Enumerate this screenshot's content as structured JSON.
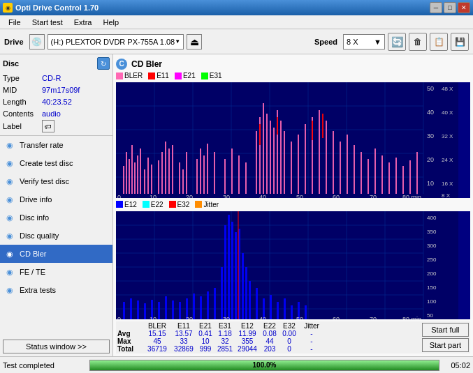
{
  "titleBar": {
    "icon": "◉",
    "title": "Opti Drive Control 1.70",
    "minBtn": "─",
    "maxBtn": "□",
    "closeBtn": "✕"
  },
  "menu": {
    "items": [
      "File",
      "Start test",
      "Extra",
      "Help"
    ]
  },
  "toolbar": {
    "driveLabel": "Drive",
    "driveIcon": "💿",
    "driveValue": "(H:)  PLEXTOR DVDR  PX-755A 1.08",
    "ejectIcon": "⏏",
    "speedLabel": "Speed",
    "speedValue": "8 X",
    "icons": [
      "🔄",
      "🗑",
      "📋",
      "💾"
    ]
  },
  "disc": {
    "title": "Disc",
    "refreshIcon": "↻",
    "fields": [
      {
        "label": "Type",
        "value": "CD-R"
      },
      {
        "label": "MID",
        "value": "97m17s09f"
      },
      {
        "label": "Length",
        "value": "40:23.52"
      },
      {
        "label": "Contents",
        "value": "audio"
      },
      {
        "label": "Label",
        "value": ""
      }
    ]
  },
  "sidebar": {
    "items": [
      {
        "id": "transfer-rate",
        "label": "Transfer rate",
        "icon": "◉"
      },
      {
        "id": "create-test-disc",
        "label": "Create test disc",
        "icon": "◉"
      },
      {
        "id": "verify-test-disc",
        "label": "Verify test disc",
        "icon": "◉"
      },
      {
        "id": "drive-info",
        "label": "Drive info",
        "icon": "◉"
      },
      {
        "id": "disc-info",
        "label": "Disc info",
        "icon": "◉"
      },
      {
        "id": "disc-quality",
        "label": "Disc quality",
        "icon": "◉"
      },
      {
        "id": "cd-bler",
        "label": "CD Bler",
        "icon": "◉",
        "active": true
      },
      {
        "id": "fe-te",
        "label": "FE / TE",
        "icon": "◉"
      },
      {
        "id": "extra-tests",
        "label": "Extra tests",
        "icon": "◉"
      }
    ],
    "statusWindowBtn": "Status window >>"
  },
  "chart": {
    "title": "CD Bler",
    "titleIcon": "C",
    "topLegend": [
      {
        "label": "BLER",
        "color": "#ff69b4"
      },
      {
        "label": "E11",
        "color": "#ff0000"
      },
      {
        "label": "E21",
        "color": "#ff00ff"
      },
      {
        "label": "E31",
        "color": "#00ff00"
      }
    ],
    "bottomLegend": [
      {
        "label": "E12",
        "color": "#0000ff"
      },
      {
        "label": "E22",
        "color": "#00ffff"
      },
      {
        "label": "E32",
        "color": "#ff0000"
      },
      {
        "label": "Jitter",
        "color": "#ff8c00"
      }
    ],
    "topYLabels": [
      "50",
      "40",
      "30",
      "20",
      "10"
    ],
    "topYRightLabels": [
      "48 X",
      "40 X",
      "32 X",
      "24 X",
      "16 X",
      "8 X"
    ],
    "bottomYLabels": [
      "400",
      "350",
      "300",
      "250",
      "200",
      "150",
      "100",
      "50"
    ],
    "xLabels": [
      "0",
      "10",
      "20",
      "30",
      "40",
      "50",
      "60",
      "70",
      "80 min"
    ]
  },
  "stats": {
    "columns": [
      "",
      "BLER",
      "E11",
      "E21",
      "E31",
      "E12",
      "E22",
      "E32",
      "Jitter",
      "",
      ""
    ],
    "rows": [
      {
        "label": "Avg",
        "values": [
          "15.15",
          "13.57",
          "0.41",
          "1.18",
          "11.99",
          "0.08",
          "0.00",
          "-"
        ]
      },
      {
        "label": "Max",
        "values": [
          "45",
          "33",
          "10",
          "32",
          "355",
          "44",
          "0",
          "-"
        ]
      },
      {
        "label": "Total",
        "values": [
          "36719",
          "32869",
          "999",
          "2851",
          "29044",
          "203",
          "0",
          "-"
        ]
      }
    ],
    "buttons": [
      "Start full",
      "Start part"
    ]
  },
  "statusBar": {
    "text": "Test completed",
    "progress": 100,
    "progressText": "100.0%",
    "time": "05:02"
  }
}
